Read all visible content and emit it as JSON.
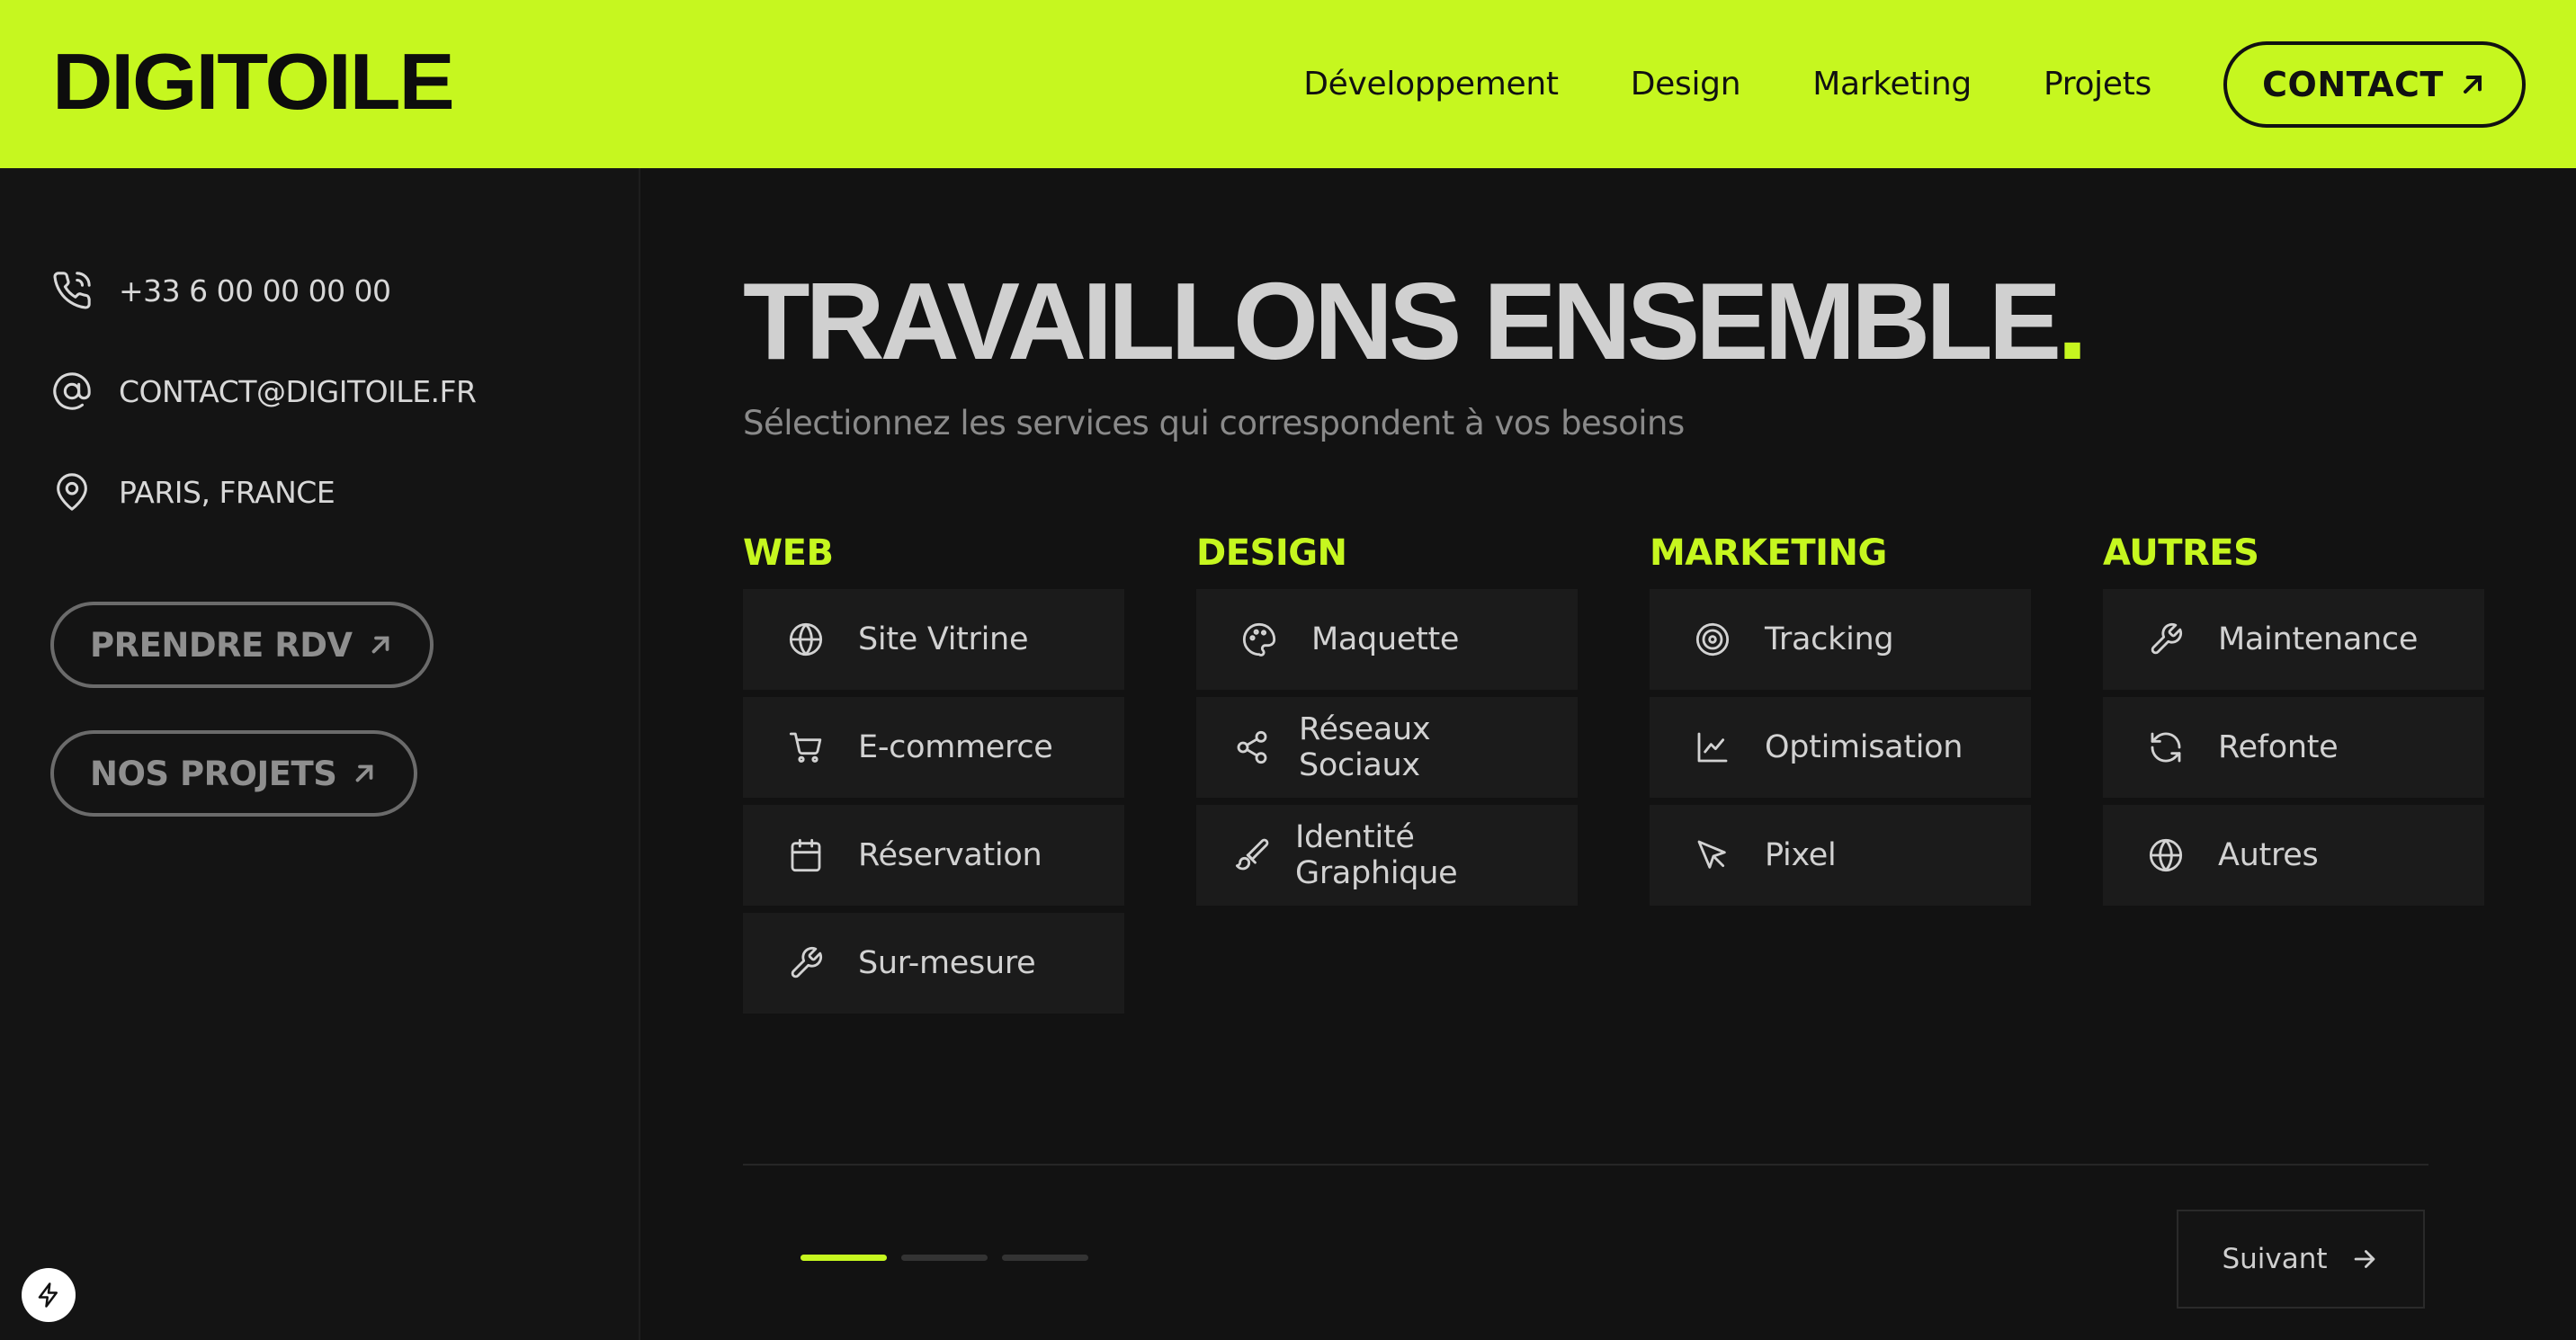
{
  "brand": {
    "logo": "DIGITOILE",
    "accent": "#c6f71f",
    "background": "#121212"
  },
  "nav": {
    "links": [
      "Développement",
      "Design",
      "Marketing",
      "Projets"
    ],
    "contact_label": "CONTACT"
  },
  "sidebar": {
    "phone": "+33 6 00 00 00 00",
    "email": "CONTACT@DIGITOILE.FR",
    "location": "PARIS, FRANCE",
    "rdv_label": "PRENDRE RDV",
    "projects_label": "NOS PROJETS"
  },
  "hero": {
    "title": "TRAVAILLONS ENSEMBLE",
    "title_dot": ".",
    "subtitle": "Sélectionnez les services qui correspondent à vos besoins"
  },
  "categories": [
    {
      "title": "WEB",
      "services": [
        {
          "label": "Site Vitrine",
          "icon": "globe-icon"
        },
        {
          "label": "E-commerce",
          "icon": "cart-icon"
        },
        {
          "label": "Réservation",
          "icon": "calendar-icon"
        },
        {
          "label": "Sur-mesure",
          "icon": "wrench-icon"
        }
      ]
    },
    {
      "title": "DESIGN",
      "services": [
        {
          "label": "Maquette",
          "icon": "palette-icon"
        },
        {
          "label": "Réseaux Sociaux",
          "icon": "share-icon"
        },
        {
          "label": "Identité Graphique",
          "icon": "brush-icon"
        }
      ]
    },
    {
      "title": "MARKETING",
      "services": [
        {
          "label": "Tracking",
          "icon": "target-icon"
        },
        {
          "label": "Optimisation",
          "icon": "line-chart-icon"
        },
        {
          "label": "Pixel",
          "icon": "cursor-icon"
        }
      ]
    },
    {
      "title": "AUTRES",
      "services": [
        {
          "label": "Maintenance",
          "icon": "wrench-icon"
        },
        {
          "label": "Refonte",
          "icon": "refresh-icon"
        },
        {
          "label": "Autres",
          "icon": "globe-icon"
        }
      ]
    }
  ],
  "stepper": {
    "current": 1,
    "total": 3
  },
  "next_label": "Suivant"
}
